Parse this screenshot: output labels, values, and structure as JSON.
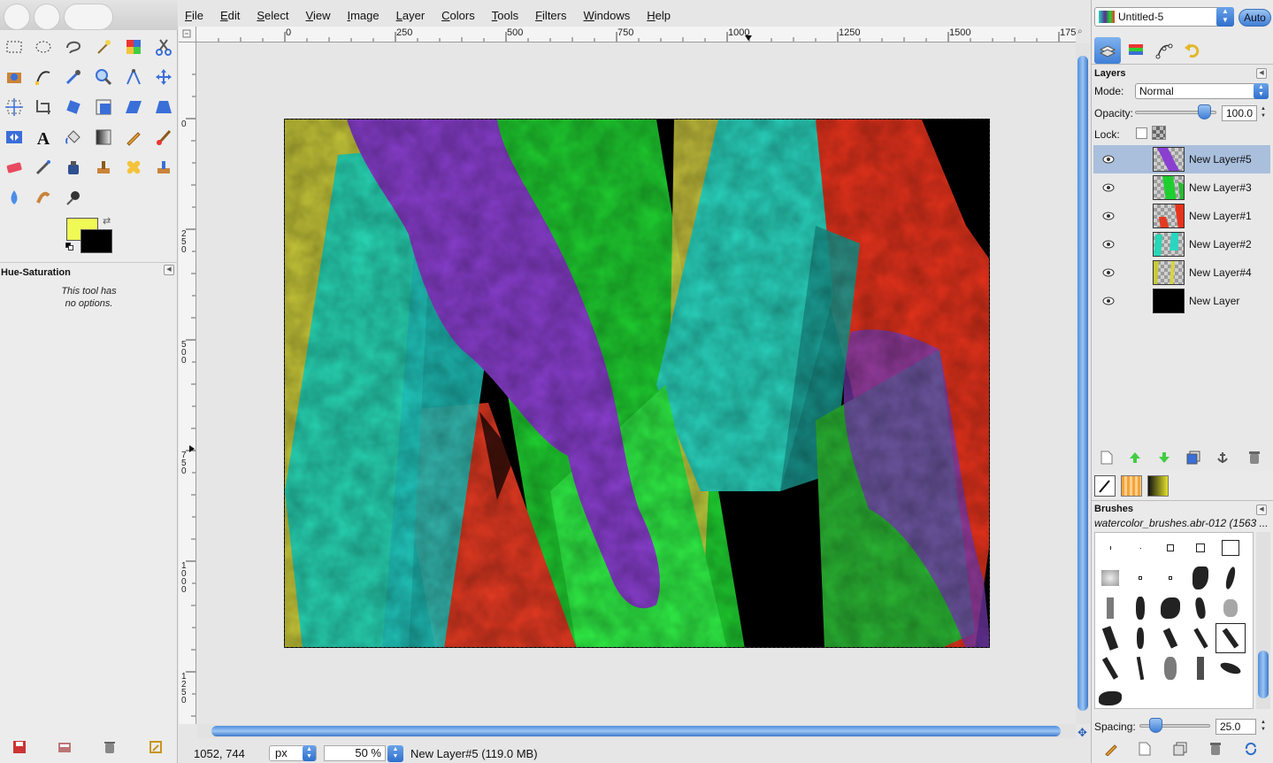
{
  "menubar": {
    "items": [
      "File",
      "Edit",
      "Select",
      "View",
      "Image",
      "Layer",
      "Colors",
      "Tools",
      "Filters",
      "Windows",
      "Help"
    ]
  },
  "toolbox": {
    "tools": [
      "rect-select",
      "ellipse-select",
      "free-select",
      "fuzzy-select",
      "by-color-select",
      "scissors-select",
      "foreground-select",
      "paths",
      "color-picker",
      "zoom",
      "measure",
      "move",
      "align",
      "crop",
      "rotate",
      "scale",
      "shear",
      "perspective",
      "flip",
      "text",
      "bucket-fill",
      "blend",
      "pencil",
      "paintbrush",
      "eraser",
      "airbrush",
      "ink",
      "clone",
      "heal",
      "perspective-clone",
      "blur",
      "smudge",
      "dodge-burn"
    ],
    "fg_color": "#f0fa55",
    "bg_color": "#000000",
    "options_title": "Hue-Saturation",
    "options_text_line1": "This tool has",
    "options_text_line2": "no options."
  },
  "rulers": {
    "top_labels": [
      "0",
      "250",
      "500",
      "750",
      "1000",
      "1250",
      "1500",
      "175"
    ],
    "left_labels": [
      "0",
      "250",
      "500",
      "750",
      "1000",
      "1250"
    ]
  },
  "status": {
    "coords": "1052, 744",
    "unit": "px",
    "zoom": "50 %",
    "message": "New Layer#5 (119.0 MB)"
  },
  "dock": {
    "image_name": "Untitled-5",
    "auto_label": "Auto",
    "layers_title": "Layers",
    "mode_label": "Mode:",
    "mode_value": "Normal",
    "opacity_label": "Opacity:",
    "opacity_value": "100.0",
    "opacity_level": 1.0,
    "lock_label": "Lock:",
    "layers": [
      {
        "name": "New Layer#5",
        "selected": true
      },
      {
        "name": "New Layer#3",
        "selected": false
      },
      {
        "name": "New Layer#1",
        "selected": false
      },
      {
        "name": "New Layer#2",
        "selected": false
      },
      {
        "name": "New Layer#4",
        "selected": false
      },
      {
        "name": "New Layer",
        "selected": false
      }
    ],
    "brushes_title": "Brushes",
    "brushes_subtitle": "watercolor_brushes.abr-012 (1563 ...",
    "spacing_label": "Spacing:",
    "spacing_value": "25.0"
  },
  "colors": {
    "accent": "#3f7fd6",
    "selected_row": "#a9bfdc"
  }
}
